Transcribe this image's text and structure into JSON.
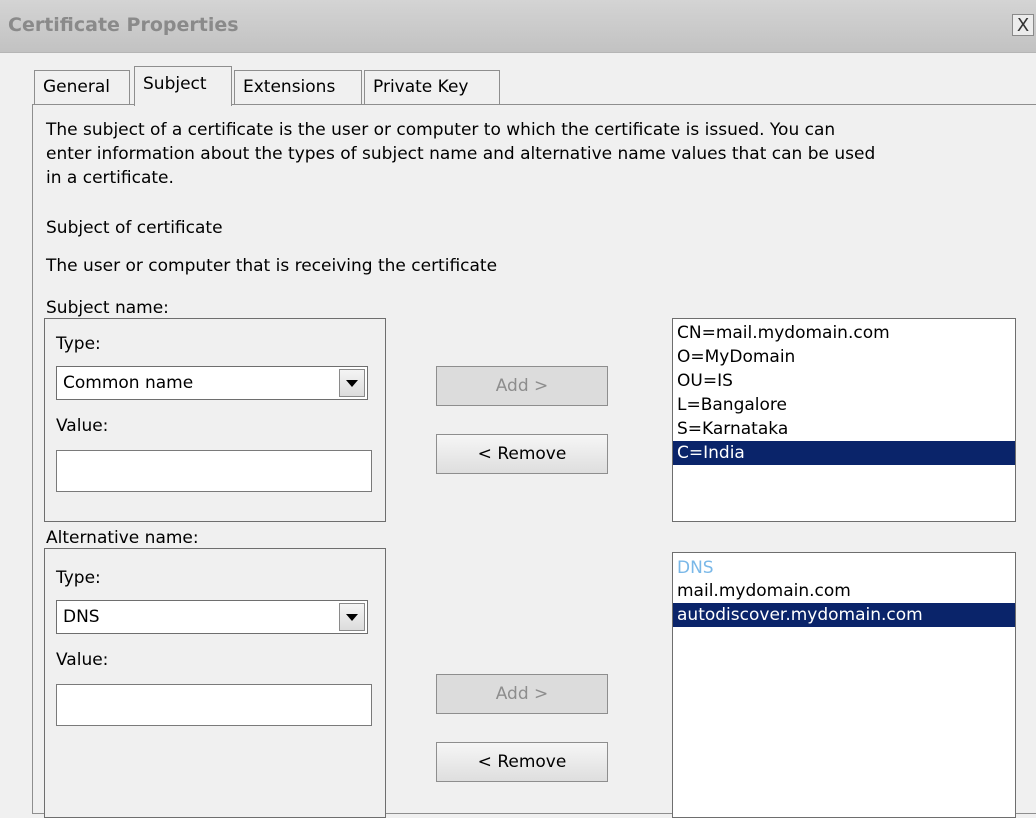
{
  "window": {
    "title": "Certificate Properties",
    "close_label": "X"
  },
  "tabs": [
    {
      "label": "General",
      "active": false
    },
    {
      "label": "Subject",
      "active": true
    },
    {
      "label": "Extensions",
      "active": false
    },
    {
      "label": "Private Key",
      "active": false
    }
  ],
  "intro": {
    "lines": [
      "The subject of a certificate is the user or computer to which the certificate is issued. You can",
      "enter information about the types of subject name and alternative name values that can be used",
      "in a certificate."
    ],
    "section_title": "Subject of certificate",
    "section_desc": "The user or computer that is receiving the certificate"
  },
  "subject_name": {
    "label": "Subject name:",
    "type_label": "Type:",
    "type_value": "Common name",
    "value_label": "Value:",
    "value_text": "",
    "add_label": "Add >",
    "remove_label": "< Remove",
    "list": [
      "CN=mail.mydomain.com",
      "O=MyDomain",
      "OU=IS",
      "L=Bangalore",
      "S=Karnataka",
      "C=India"
    ],
    "selected_index": 5
  },
  "alternative_name": {
    "label": "Alternative name:",
    "type_label": "Type:",
    "type_value": "DNS",
    "value_label": "Value:",
    "value_text": "",
    "add_label": "Add >",
    "remove_label": "< Remove",
    "list_header": "DNS",
    "list": [
      "mail.mydomain.com",
      "autodiscover.mydomain.com"
    ],
    "selected_index": 1
  },
  "colors": {
    "selection": "#0a246a",
    "list_header": "#7ab8e8",
    "disabled_text": "#8d8d8d"
  }
}
